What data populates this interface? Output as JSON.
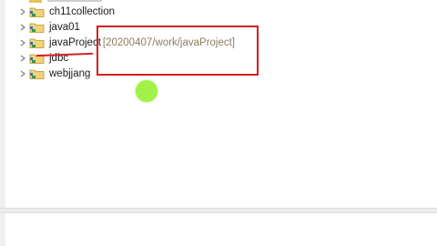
{
  "tree": {
    "items": [
      {
        "label": "ch11collection",
        "path": ""
      },
      {
        "label": "java01",
        "path": ""
      },
      {
        "label": "javaProject",
        "path": "[20200407/work/javaProject]"
      },
      {
        "label": "jdbc",
        "path": ""
      },
      {
        "label": "webjjang",
        "path": ""
      }
    ]
  },
  "colors": {
    "annotation": "#d32020",
    "cursor": "#9bf03a",
    "path_text": "#8d7c5d"
  }
}
